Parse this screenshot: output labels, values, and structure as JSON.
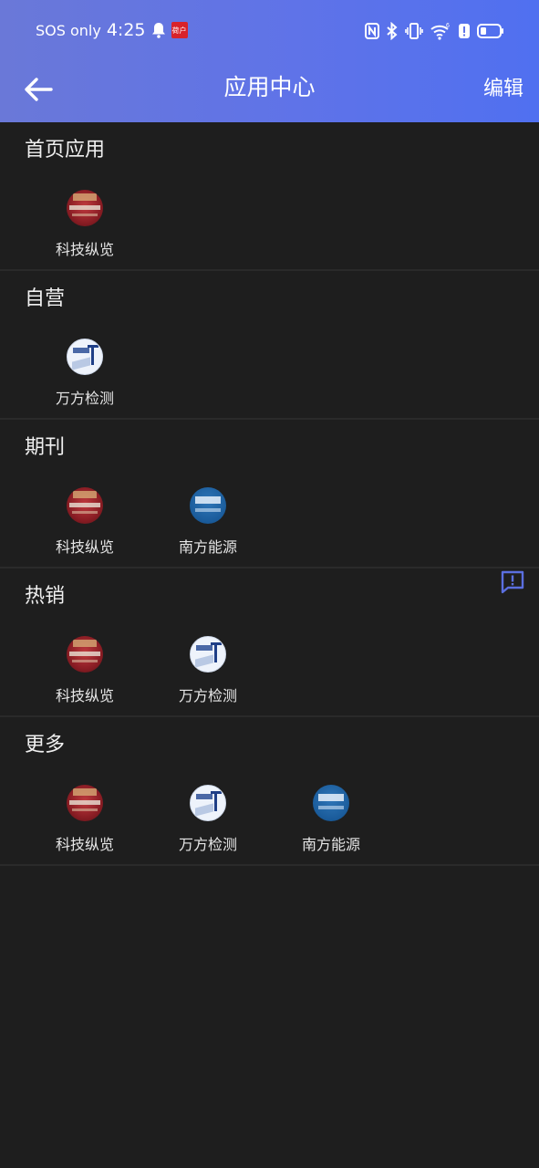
{
  "status_bar": {
    "sos": "SOS only",
    "time": "4:25",
    "app_badge": "荷户"
  },
  "header": {
    "title": "应用中心",
    "edit_label": "编辑"
  },
  "sections": [
    {
      "title": "首页应用",
      "apps": [
        {
          "label": "科技纵览",
          "icon": "keji-zonglan-logo"
        }
      ]
    },
    {
      "title": "自营",
      "apps": [
        {
          "label": "万方检测",
          "icon": "wanfang-jiance-logo"
        }
      ]
    },
    {
      "title": "期刊",
      "apps": [
        {
          "label": "科技纵览",
          "icon": "keji-zonglan-logo"
        },
        {
          "label": "南方能源",
          "icon": "nanfang-nengyuan-logo"
        }
      ]
    },
    {
      "title": "热销",
      "apps": [
        {
          "label": "科技纵览",
          "icon": "keji-zonglan-logo"
        },
        {
          "label": "万方检测",
          "icon": "wanfang-jiance-logo"
        }
      ]
    },
    {
      "title": "更多",
      "apps": [
        {
          "label": "科技纵览",
          "icon": "keji-zonglan-logo"
        },
        {
          "label": "万方检测",
          "icon": "wanfang-jiance-logo"
        },
        {
          "label": "南方能源",
          "icon": "nanfang-nengyuan-logo"
        }
      ]
    }
  ],
  "colors": {
    "header_start": "#6a78d8",
    "header_end": "#5070f0",
    "background": "#1e1e1e",
    "feedback_icon": "#5b6fe0"
  }
}
